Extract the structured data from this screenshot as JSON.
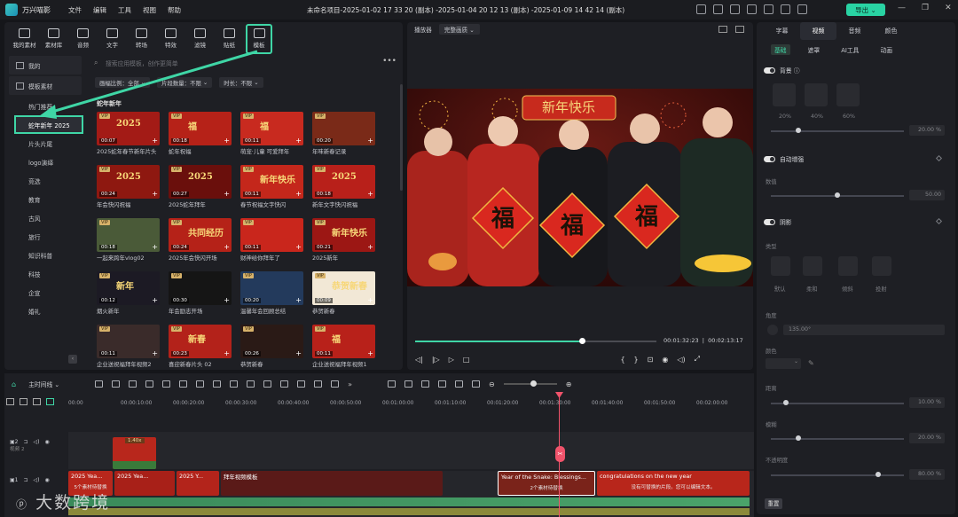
{
  "app": {
    "name": "万兴喵影",
    "menu": [
      "文件",
      "编辑",
      "工具",
      "视图",
      "帮助"
    ],
    "window_title": "未命名项目-2025-01-02 17 33 20 (副本) -2025-01-04 20 12 13 (副本) -2025-01-09 14 42 14 (副本)",
    "export_label": "导出"
  },
  "toolstrip": {
    "items": [
      {
        "label": "我的素材",
        "icon": "folder-icon"
      },
      {
        "label": "素材库",
        "icon": "library-icon"
      },
      {
        "label": "音频",
        "icon": "music-icon"
      },
      {
        "label": "文字",
        "icon": "text-icon"
      },
      {
        "label": "转场",
        "icon": "transition-icon"
      },
      {
        "label": "特效",
        "icon": "effects-icon"
      },
      {
        "label": "滤镜",
        "icon": "filter-icon"
      },
      {
        "label": "贴纸",
        "icon": "sticker-icon"
      },
      {
        "label": "模板",
        "icon": "template-icon"
      }
    ]
  },
  "sidebar": {
    "items": [
      "我的",
      "模板素材",
      "热门推荐",
      "蛇年新年 2025",
      "片头片尾",
      "logo演绎",
      "竞选",
      "教育",
      "古风",
      "旅行",
      "知识科普",
      "科技",
      "企宣",
      "婚礼",
      "婚礼"
    ]
  },
  "search": {
    "placeholder": "搜索应用模板，创作更简单"
  },
  "filters": [
    "画幅比例：全部",
    "片段数量：不限",
    "时长：不限"
  ],
  "section_title": "蛇年新年",
  "templates": [
    {
      "cap": "2025蛇年春节新年片头",
      "dur": "00:07",
      "vip": "VIP",
      "bg": "#a31b16",
      "art": "2025"
    },
    {
      "cap": "蛇年祝福",
      "dur": "00:18",
      "vip": "VIP",
      "bg": "#b62218",
      "art": "福"
    },
    {
      "cap": "萌宠·儿童 可爱拜年",
      "dur": "00:11",
      "vip": "VIP",
      "bg": "#c82a1f",
      "art": "福"
    },
    {
      "cap": "年味新春记录",
      "dur": "00:20",
      "vip": "VIP",
      "bg": "#7a2a18",
      "art": ""
    },
    {
      "cap": "年会快闪祝福",
      "dur": "00:24",
      "vip": "VIP",
      "bg": "#8e1810",
      "art": "2025"
    },
    {
      "cap": "2025蛇年拜年",
      "dur": "00:27",
      "vip": "VIP",
      "bg": "#6a0f0c",
      "art": "2025"
    },
    {
      "cap": "春节祝福文字快闪",
      "dur": "00:11",
      "vip": "VIP",
      "bg": "#c4271b",
      "art": "新年快乐"
    },
    {
      "cap": "新年文字快闪祝福",
      "dur": "00:18",
      "vip": "VIP",
      "bg": "#b8201a",
      "art": "2025"
    },
    {
      "cap": "一起来跨年vlog02",
      "dur": "00:18",
      "vip": "VIP",
      "bg": "#4a5a38",
      "art": ""
    },
    {
      "cap": "2025年会快闪开场",
      "dur": "00:24",
      "vip": "VIP",
      "bg": "#b52218",
      "art": "共同经历"
    },
    {
      "cap": "财神给你拜年了",
      "dur": "00:11",
      "vip": "VIP",
      "bg": "#c9261c",
      "art": ""
    },
    {
      "cap": "2025新年",
      "dur": "00:21",
      "vip": "VIP",
      "bg": "#9c1714",
      "art": "新年快乐"
    },
    {
      "cap": "烟火新年",
      "dur": "00:12",
      "vip": "VIP",
      "bg": "#1c1a24",
      "art": "新年"
    },
    {
      "cap": "年会励志开场",
      "dur": "00:30",
      "vip": "VIP",
      "bg": "#151515",
      "art": ""
    },
    {
      "cap": "温馨年会回顾总结",
      "dur": "00:20",
      "vip": "VIP",
      "bg": "#233a5c",
      "art": ""
    },
    {
      "cap": "恭贺新春",
      "dur": "00:09",
      "vip": "VIP",
      "bg": "#f2e8d6",
      "art": "恭贺新春"
    },
    {
      "cap": "企业送祝福拜年视频2",
      "dur": "00:11",
      "vip": "VIP",
      "bg": "#3a2b2a",
      "art": ""
    },
    {
      "cap": "喜迎新春片头 02",
      "dur": "00:23",
      "vip": "VIP",
      "bg": "#b3221a",
      "art": "新春"
    },
    {
      "cap": "恭贺新春",
      "dur": "00:26",
      "vip": "VIP",
      "bg": "#2a1a16",
      "art": ""
    },
    {
      "cap": "企业送祝福拜年视频1",
      "dur": "00:11",
      "vip": "VIP",
      "bg": "#b8211a",
      "art": "福"
    }
  ],
  "preview": {
    "label": "播放器",
    "quality": "完整画质",
    "banner": "新年快乐",
    "couplet": "福",
    "current": "00:01:32:23",
    "total": "00:02:13:17",
    "progress": 0.69
  },
  "props": {
    "tabs": [
      "字幕",
      "视频",
      "音频",
      "颜色"
    ],
    "subtabs": [
      "基础",
      "遮罩",
      "AI工具",
      "动画"
    ],
    "sections": [
      {
        "title": "背景 ⓘ",
        "labels": [
          "20%",
          "40%",
          "60%"
        ],
        "value": "20.00 %"
      },
      {
        "title": "自动增强",
        "label": "数值",
        "value": "50.00"
      },
      {
        "title": "阴影",
        "label": "类型",
        "types": [
          "默认",
          "柔和",
          "倾斜",
          "投射"
        ],
        "angle_label": "角度",
        "angle": "135.00°",
        "color_label": "颜色",
        "distance_label": "距离",
        "distance": "10.00 %",
        "blur_label": "模糊",
        "blur": "20.00 %",
        "opacity_label": "不透明度",
        "opacity": "80.00 %"
      }
    ],
    "reset_label": "重置"
  },
  "timeline": {
    "sequence_label": "主时间线",
    "ruler": [
      "00:00",
      "00:00:10:00",
      "00:00:20:00",
      "00:00:30:00",
      "00:00:40:00",
      "00:00:50:00",
      "00:01:00:00",
      "00:01:10:00",
      "00:01:20:00",
      "00:01:30:00",
      "00:01:40:00",
      "00:01:50:00",
      "00:02:00:00"
    ],
    "track2": {
      "label": "视频 2",
      "clip_speed": "1.40x"
    },
    "track1_clips": [
      {
        "title": "2025 Yea...",
        "sub": "5个素材待替换"
      },
      {
        "title": "2025 Yea...",
        "sub": ""
      },
      {
        "title": "2025 Y...",
        "sub": ""
      },
      {
        "title": "拜年视频模板",
        "sub": ""
      },
      {
        "title": "Year of the Snake: Blessings...",
        "sub": "2个素材待替换"
      },
      {
        "title": "congratulations on the new year",
        "sub": "没有可替换的片段。您可以编辑文本。"
      }
    ]
  },
  "watermark": "大数跨境",
  "colors": {
    "accent": "#3fd6a6",
    "playhead": "#f0536b"
  }
}
